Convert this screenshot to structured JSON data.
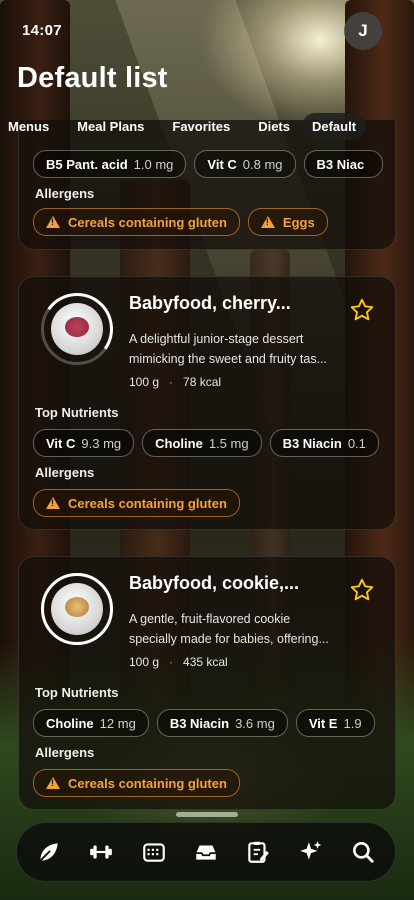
{
  "status_bar": {
    "time": "14:07"
  },
  "profile": {
    "initial": "J"
  },
  "page": {
    "title": "Default list"
  },
  "tabs": [
    "Menus",
    "Meal Plans",
    "Favorites",
    "Diets",
    "Default"
  ],
  "partial_card": {
    "nutrients": [
      {
        "name": "B5 Pant. acid",
        "value": "1.0 mg"
      },
      {
        "name": "Vit C",
        "value": "0.8 mg"
      },
      {
        "name": "B3 Niac",
        "value": ""
      }
    ],
    "allergens_label": "Allergens",
    "allergens": [
      "Cereals containing gluten",
      "Eggs"
    ]
  },
  "cards": [
    {
      "name": "Babyfood, cherry...",
      "description_line1": "A delightful junior-stage dessert",
      "description_line2": "mimicking the sweet and fruity tas...",
      "amount": "100 g",
      "calories": "78 kcal",
      "nutrients_label": "Top Nutrients",
      "nutrients": [
        {
          "name": "Vit C",
          "value": "9.3 mg"
        },
        {
          "name": "Choline",
          "value": "1.5 mg"
        },
        {
          "name": "B3 Niacin",
          "value": "0.1"
        }
      ],
      "allergens_label": "Allergens",
      "allergens": [
        "Cereals containing gluten"
      ]
    },
    {
      "name": "Babyfood, cookie,...",
      "description_line1": "A gentle, fruit-flavored cookie",
      "description_line2": "specially made for babies, offering...",
      "amount": "100 g",
      "calories": "435 kcal",
      "nutrients_label": "Top Nutrients",
      "nutrients": [
        {
          "name": "Choline",
          "value": "12 mg"
        },
        {
          "name": "B3 Niacin",
          "value": "3.6 mg"
        },
        {
          "name": "Vit E",
          "value": "1.9"
        }
      ],
      "allergens_label": "Allergens",
      "allergens": [
        "Cereals containing gluten"
      ]
    }
  ],
  "nav": [
    "leaf-icon",
    "dumbbell-icon",
    "calendar-icon",
    "inbox-tray-icon",
    "clipboard-edit-icon",
    "sparkles-icon",
    "search-icon"
  ],
  "colors": {
    "accent_star": "#f5c518",
    "allergen": "#f2a23c"
  }
}
